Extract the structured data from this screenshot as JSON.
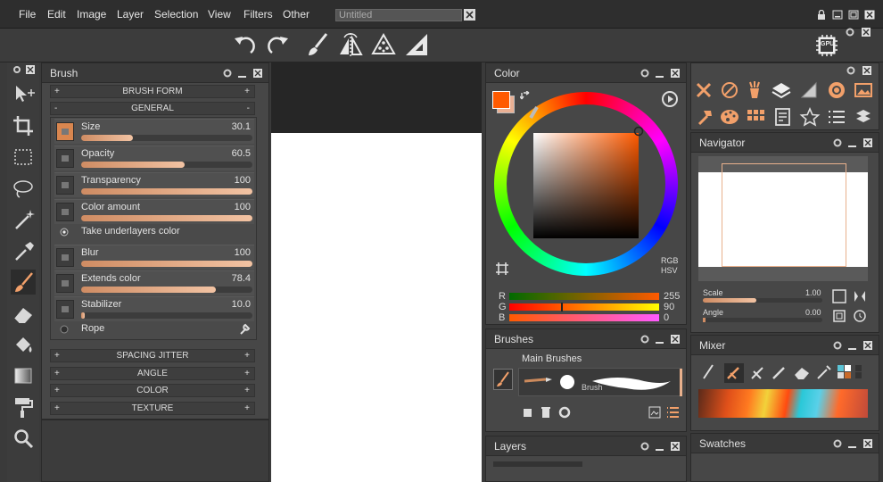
{
  "menu": [
    "File",
    "Edit",
    "Image",
    "Layer",
    "Selection",
    "View",
    "Filters",
    "Other"
  ],
  "document_tab": "Untitled",
  "toolbar_icons": [
    "undo-icon",
    "redo-icon",
    "brush-icon",
    "symmetry-icon",
    "triangle-dots-icon",
    "ruler-icon"
  ],
  "gpu_label": "GPU",
  "left_tools": [
    "move-icon",
    "crop-icon",
    "rect-select-icon",
    "lasso-icon",
    "magic-wand-icon",
    "eyedropper-icon",
    "brush-icon",
    "eraser-icon",
    "fill-icon",
    "gradient-icon",
    "paint-roller-icon",
    "zoom-icon"
  ],
  "brush_panel": {
    "title": "Brush",
    "sections_top": [
      "BRUSH FORM",
      "GENERAL"
    ],
    "params": [
      {
        "label": "Size",
        "value": "30.1",
        "fill": 0.3
      },
      {
        "label": "Opacity",
        "value": "60.5",
        "fill": 0.605
      },
      {
        "label": "Transparency",
        "value": "100",
        "fill": 1.0
      },
      {
        "label": "Color amount",
        "value": "100",
        "fill": 1.0
      }
    ],
    "take_underlayers": "Take underlayers color",
    "params2": [
      {
        "label": "Blur",
        "value": "100",
        "fill": 1.0
      },
      {
        "label": "Extends color",
        "value": "78.4",
        "fill": 0.784
      },
      {
        "label": "Stabilizer",
        "value": "10.0",
        "fill": 0.02
      }
    ],
    "rope": "Rope",
    "sections_bottom": [
      "SPACING JITTER",
      "ANGLE",
      "COLOR",
      "TEXTURE"
    ]
  },
  "color_panel": {
    "title": "Color",
    "rgb_hsv": [
      "RGB",
      "HSV"
    ],
    "rgb": [
      {
        "label": "R",
        "value": "255"
      },
      {
        "label": "G",
        "value": "90"
      },
      {
        "label": "B",
        "value": "0"
      }
    ],
    "primary_color": "#ff5a00"
  },
  "brushes_panel": {
    "title": "Brushes",
    "group": "Main Brushes",
    "brush_name": "Brush"
  },
  "layers_panel": {
    "title": "Layers"
  },
  "navigator_panel": {
    "title": "Navigator",
    "scale_label": "Scale",
    "scale_value": "1.00",
    "angle_label": "Angle",
    "angle_value": "0.00"
  },
  "mixer_panel": {
    "title": "Mixer"
  },
  "swatches_panel": {
    "title": "Swatches"
  }
}
